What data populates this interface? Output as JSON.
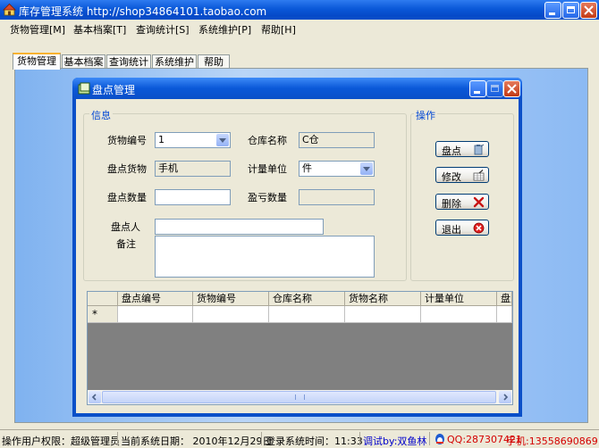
{
  "app": {
    "title": "库存管理系统 http://shop34864101.taobao.com"
  },
  "menu": [
    "货物管理[M]",
    "基本档案[T]",
    "查询统计[S]",
    "系统维护[P]",
    "帮助[H]"
  ],
  "tabs": [
    "货物管理",
    "基本档案",
    "查询统计",
    "系统维护",
    "帮助"
  ],
  "dialog": {
    "title": "盘点管理",
    "info_group": "信息",
    "ops_group": "操作",
    "fields": {
      "goods_no_label": "货物编号",
      "goods_no_value": "1",
      "warehouse_label": "仓库名称",
      "warehouse_value": "C仓",
      "check_goods_label": "盘点货物",
      "check_goods_value": "手机",
      "unit_label": "计量单位",
      "unit_value": "件",
      "check_qty_label": "盘点数量",
      "check_qty_value": "",
      "profit_loss_label": "盈亏数量",
      "profit_loss_value": "",
      "checker_label": "盘点人",
      "checker_value": "",
      "remark_label": "备注",
      "remark_value": ""
    },
    "buttons": {
      "check": "盘点",
      "modify": "修改",
      "delete": "删除",
      "exit": "退出"
    },
    "grid": {
      "columns": [
        "盘点编号",
        "货物编号",
        "仓库名称",
        "货物名称",
        "计量单位",
        "盘点"
      ],
      "new_row_marker": "*"
    }
  },
  "status": {
    "user": "操作用户权限：超级管理员",
    "date": "当前系统日期： 2010年12月29日",
    "login_time": "登录系统时间：11:33",
    "debug": "调试by:双鱼林",
    "qq": "QQ:287307421",
    "phone": "手机:13558690869"
  },
  "colors": {
    "titlebar": "#0A4FC8",
    "accent_tab": "#F8B230",
    "group_label": "#0046D5",
    "qq_text": "#D40000",
    "debug_text": "#0000CC"
  }
}
